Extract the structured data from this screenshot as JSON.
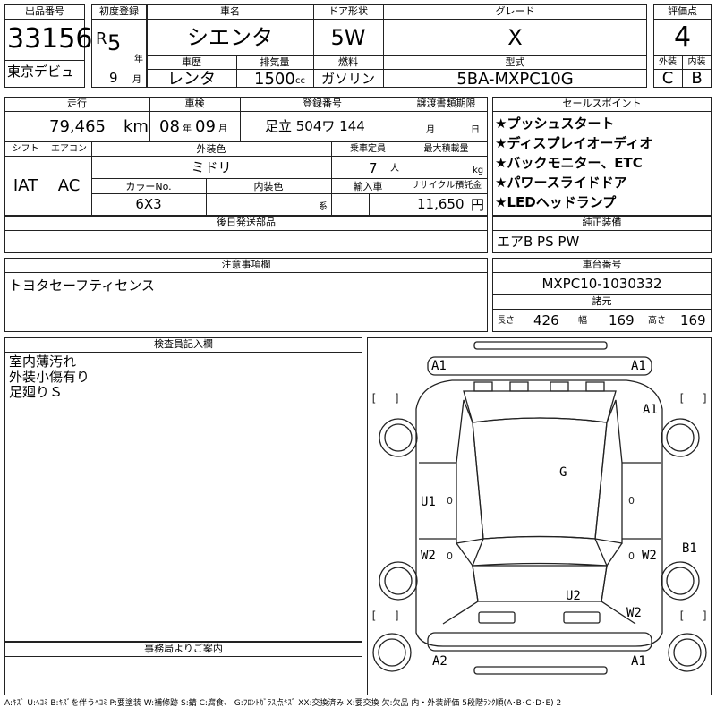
{
  "header": {
    "lot_label": "出品番号",
    "lot_no": "33156",
    "debut": "東京デビュ",
    "first_reg_label": "初度登録",
    "era": "R",
    "year": "5",
    "year_unit": "年",
    "month": "9",
    "month_unit": "月",
    "car_name_label": "車名",
    "car_name": "シエンタ",
    "history_label": "車歴",
    "history": "レンタ",
    "displacement_label": "排気量",
    "displacement": "1500",
    "displacement_unit": "cc",
    "door_label": "ドア形状",
    "door": "5W",
    "fuel_label": "燃料",
    "fuel": "ガソリン",
    "grade_label": "グレード",
    "grade": "X",
    "model_label": "型式",
    "model": "5BA-MXPC10G",
    "score_label": "評価点",
    "score": "4",
    "exterior_label": "外装",
    "exterior": "C",
    "interior_label": "内装",
    "interior": "B"
  },
  "row2": {
    "mileage_label": "走行",
    "mileage": "79,465",
    "mileage_unit": "km",
    "inspection_label": "車検",
    "insp_year": "08",
    "insp_year_unit": "年",
    "insp_month": "09",
    "insp_month_unit": "月",
    "reg_label": "登録番号",
    "reg_no": "足立 504ワ 144",
    "transfer_label": "譲渡書類期限",
    "transfer_month_unit": "月",
    "transfer_day_unit": "日"
  },
  "row3": {
    "shift_label": "シフト",
    "shift": "IAT",
    "ac_label": "エアコン",
    "ac": "AC",
    "color_label": "外装色",
    "color": "ミドリ",
    "capacity_label": "乗車定員",
    "capacity": "7",
    "capacity_unit": "人",
    "load_label": "最大積載量",
    "load_unit": "kg",
    "color_no_label": "カラーNo.",
    "color_no": "6X3",
    "int_color_label": "内装色",
    "int_color_unit": "系",
    "import_label": "輸入車",
    "recycle_label": "リサイクル預託金",
    "recycle": "11,650",
    "recycle_unit": "円"
  },
  "sales_points": {
    "label": "セールスポイント",
    "items": [
      "★プッシュスタート",
      "★ディスプレイオーディオ",
      "★バックモニター、ETC",
      "★パワースライドドア",
      "★LEDヘッドランプ"
    ]
  },
  "later_parts": {
    "label": "後日発送部品",
    "value": ""
  },
  "equipment": {
    "label": "純正装備",
    "value": "エアB PS PW"
  },
  "notes": {
    "label": "注意事項欄",
    "value": "トヨタセーフティセンス"
  },
  "chassis": {
    "label": "車台番号",
    "value": "MXPC10-1030332"
  },
  "dimensions": {
    "label": "諸元",
    "length_label": "長さ",
    "length": "426",
    "width_label": "幅",
    "width": "169",
    "height_label": "高さ",
    "height": "169"
  },
  "inspector": {
    "label": "検査員記入欄",
    "lines": [
      "室内薄汚れ",
      "外装小傷有り",
      "足廻りＳ"
    ]
  },
  "office": {
    "label": "事務局よりご案内",
    "value": ""
  },
  "diagram_marks": [
    "A1",
    "A1",
    "A1",
    "G",
    "U1",
    "W2",
    "W2",
    "B1",
    "U2",
    "W2",
    "A2",
    "A1"
  ],
  "legend": "A:ｷｽﾞ U:ﾍｺﾐ B:ｷｽﾞを伴うﾍｺﾐ P:要塗装 W:補修跡 S:錆 C:腐食、 G:ﾌﾛﾝﾄｶﾞﾗｽ点ｷｽﾞ XX:交換済み X:要交換 欠:欠品 内・外装評価 5段階ﾗﾝｸ順(A･B･C･D･E) 2"
}
